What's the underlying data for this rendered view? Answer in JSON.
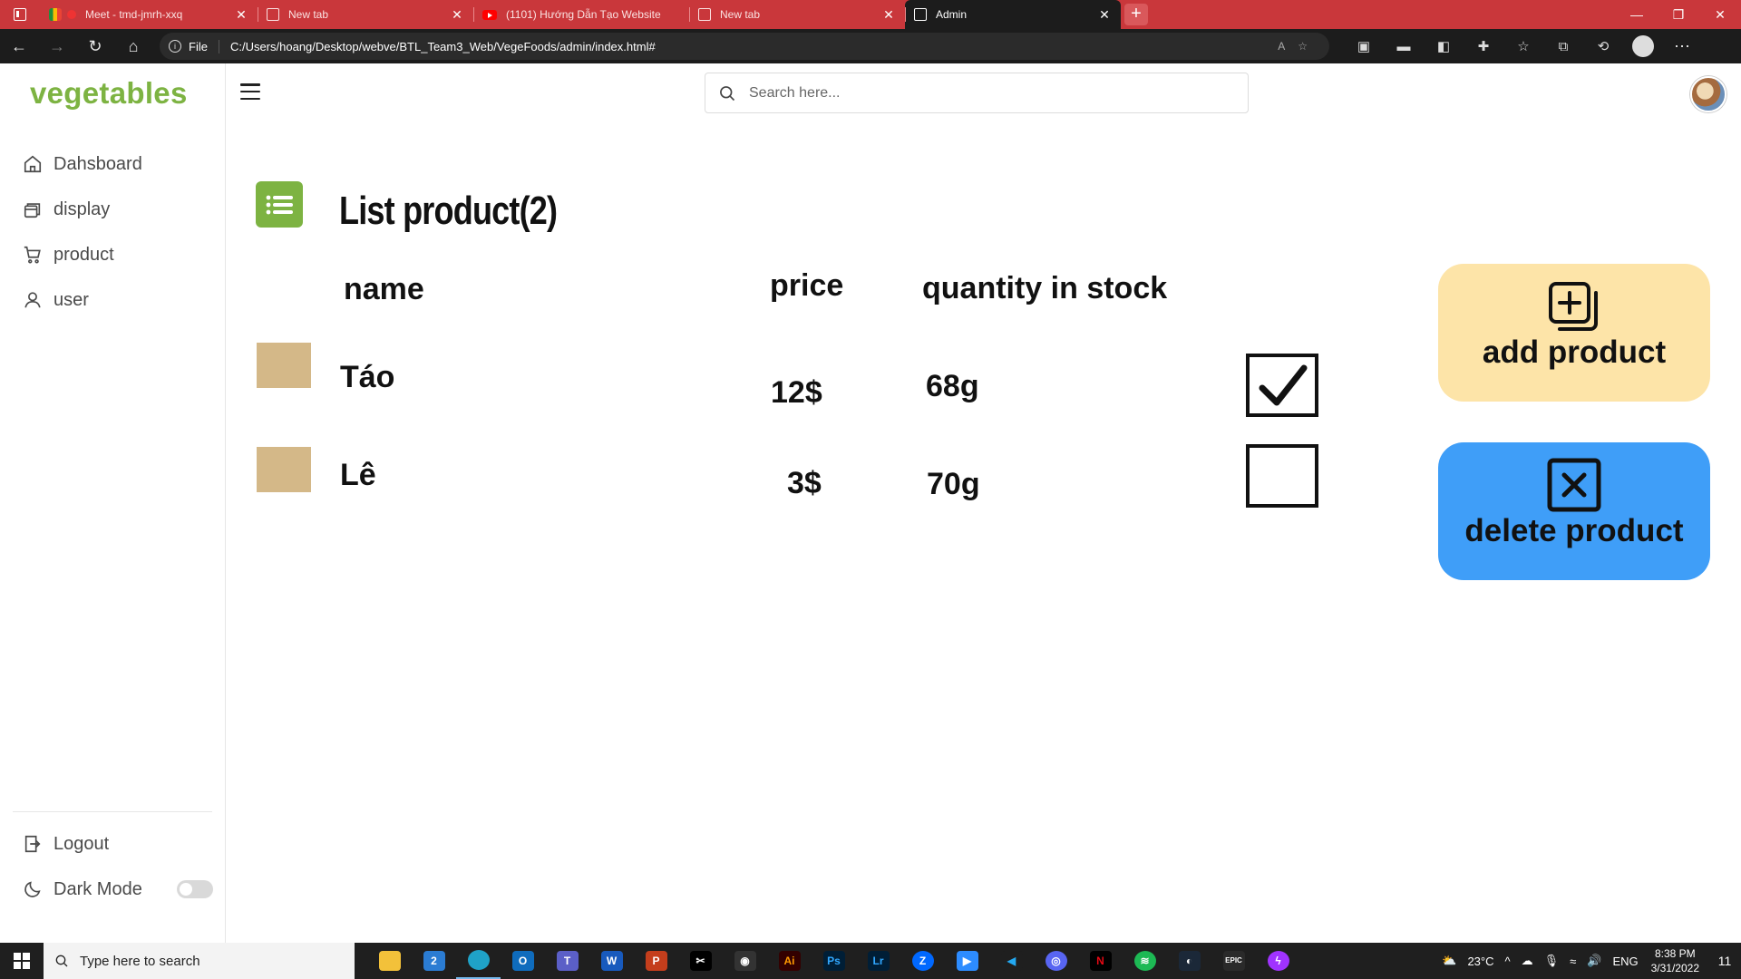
{
  "browser": {
    "tabs": [
      {
        "title": "Meet - tmd-jmrh-xxq",
        "icon": "meet-icon"
      },
      {
        "title": "New tab",
        "icon": "page-icon"
      },
      {
        "title": "(1101) Hướng Dẫn Tạo Website",
        "icon": "youtube-icon"
      },
      {
        "title": "New tab",
        "icon": "page-icon"
      },
      {
        "title": "Admin",
        "icon": "page-icon",
        "active": true
      }
    ],
    "address_scheme": "File",
    "address_url": "C:/Users/hoang/Desktop/webve/BTL_Team3_Web/VegeFoods/admin/index.html#"
  },
  "sidebar": {
    "logo": "vegetables",
    "items": [
      {
        "label": "Dahsboard",
        "icon": "home-icon"
      },
      {
        "label": "display",
        "icon": "cards-icon"
      },
      {
        "label": "product",
        "icon": "cart-icon"
      },
      {
        "label": "user",
        "icon": "user-icon"
      }
    ],
    "logout_label": "Logout",
    "dark_mode_label": "Dark Mode",
    "dark_mode_on": false
  },
  "topbar": {
    "search_placeholder": "Search here..."
  },
  "content": {
    "heading": "List product(2)",
    "columns": {
      "name": "name",
      "price": "price",
      "stock": "quantity in stock"
    },
    "products": [
      {
        "name": "Táo",
        "price": "12$",
        "stock": "68g",
        "checked": true
      },
      {
        "name": "Lê",
        "price": "3$",
        "stock": "70g",
        "checked": false
      }
    ],
    "add_label": "add product",
    "delete_label": "delete product",
    "colors": {
      "accent_green": "#7db342",
      "add_card": "#fde4a8",
      "delete_card": "#3f9ef8",
      "thumb": "#d4b888"
    }
  },
  "taskbar": {
    "search_placeholder": "Type here to search",
    "temperature": "23°C",
    "language": "ENG",
    "time": "8:38 PM",
    "date": "3/31/2022",
    "mail_badge": "2",
    "notification_count": "11"
  }
}
